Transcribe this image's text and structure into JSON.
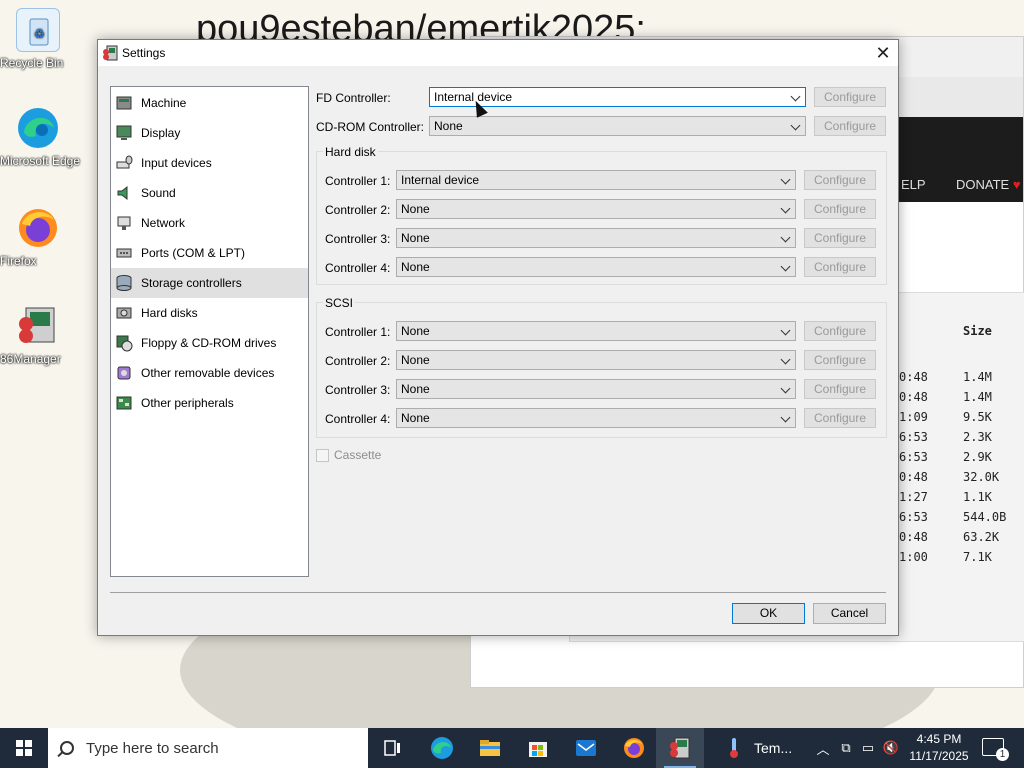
{
  "desktop": {
    "banner_text": "pou9esteban/emertik2025:",
    "icons": [
      {
        "label": "Recycle Bin",
        "name": "recycle-bin-icon"
      },
      {
        "label": "Microsoft Edge",
        "name": "edge-icon"
      },
      {
        "label": "Firefox",
        "name": "firefox-icon"
      },
      {
        "label": "86Manager",
        "name": "86box-manager-icon"
      }
    ]
  },
  "browser": {
    "nav_help": "ELP",
    "nav_donate": "DONATE",
    "size_header": "Size",
    "rows": [
      {
        "time": "0:48",
        "size": "1.4M"
      },
      {
        "time": "0:48",
        "size": "1.4M"
      },
      {
        "time": "1:09",
        "size": "9.5K"
      },
      {
        "time": "6:53",
        "size": "2.3K"
      },
      {
        "time": "6:53",
        "size": "2.9K"
      },
      {
        "time": "0:48",
        "size": "32.0K"
      },
      {
        "time": "1:27",
        "size": "1.1K"
      },
      {
        "time": "6:53",
        "size": "544.0B"
      },
      {
        "time": "0:48",
        "size": "63.2K"
      },
      {
        "time": "1:00",
        "size": "7.1K"
      }
    ]
  },
  "dialog": {
    "title": "Settings",
    "nav": [
      {
        "label": "Machine",
        "icon": "machine-icon"
      },
      {
        "label": "Display",
        "icon": "display-icon"
      },
      {
        "label": "Input devices",
        "icon": "input-devices-icon"
      },
      {
        "label": "Sound",
        "icon": "sound-icon"
      },
      {
        "label": "Network",
        "icon": "network-icon"
      },
      {
        "label": "Ports (COM & LPT)",
        "icon": "ports-icon"
      },
      {
        "label": "Storage controllers",
        "icon": "storage-controllers-icon"
      },
      {
        "label": "Hard disks",
        "icon": "hard-disks-icon"
      },
      {
        "label": "Floppy & CD-ROM drives",
        "icon": "floppy-cdrom-icon"
      },
      {
        "label": "Other removable devices",
        "icon": "removable-devices-icon"
      },
      {
        "label": "Other peripherals",
        "icon": "peripherals-icon"
      }
    ],
    "selected_nav": "Storage controllers",
    "fd_controller": {
      "label": "FD Controller:",
      "value": "Internal device"
    },
    "cdrom_controller": {
      "label": "CD-ROM Controller:",
      "value": "None"
    },
    "configure_label": "Configure",
    "hard_disk": {
      "title": "Hard disk",
      "controllers": [
        {
          "label": "Controller 1:",
          "value": "Internal device"
        },
        {
          "label": "Controller 2:",
          "value": "None"
        },
        {
          "label": "Controller 3:",
          "value": "None"
        },
        {
          "label": "Controller 4:",
          "value": "None"
        }
      ]
    },
    "scsi": {
      "title": "SCSI",
      "controllers": [
        {
          "label": "Controller 1:",
          "value": "None"
        },
        {
          "label": "Controller 2:",
          "value": "None"
        },
        {
          "label": "Controller 3:",
          "value": "None"
        },
        {
          "label": "Controller 4:",
          "value": "None"
        }
      ]
    },
    "cassette": {
      "label": "Cassette",
      "checked": false,
      "enabled": false
    },
    "ok_label": "OK",
    "cancel_label": "Cancel"
  },
  "taskbar": {
    "search_placeholder": "Type here to search",
    "tem_label": "Tem...",
    "time": "4:45 PM",
    "date": "11/17/2025",
    "notification_count": "1"
  }
}
